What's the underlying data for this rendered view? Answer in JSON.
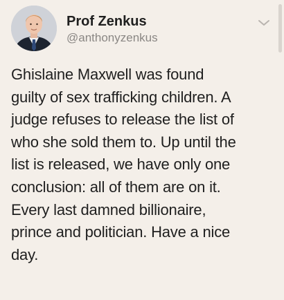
{
  "author": {
    "display_name": "Prof Zenkus",
    "handle": "@anthonyzenkus"
  },
  "icons": {
    "menu": "chevron-down-icon",
    "avatar": "profile-photo"
  },
  "tweet": {
    "text": "Ghislaine Maxwell was found\nguilty of sex trafficking children. A\njudge refuses to release the list of\nwho she sold them to. Up until the\nlist is released, we have only one\nconclusion: all of them are on it.\nEvery last damned billionaire,\nprince and politician. Have a nice\nday."
  },
  "colors": {
    "background": "#f4efe9",
    "text": "#1f1f1f",
    "handle": "#8a8784"
  }
}
